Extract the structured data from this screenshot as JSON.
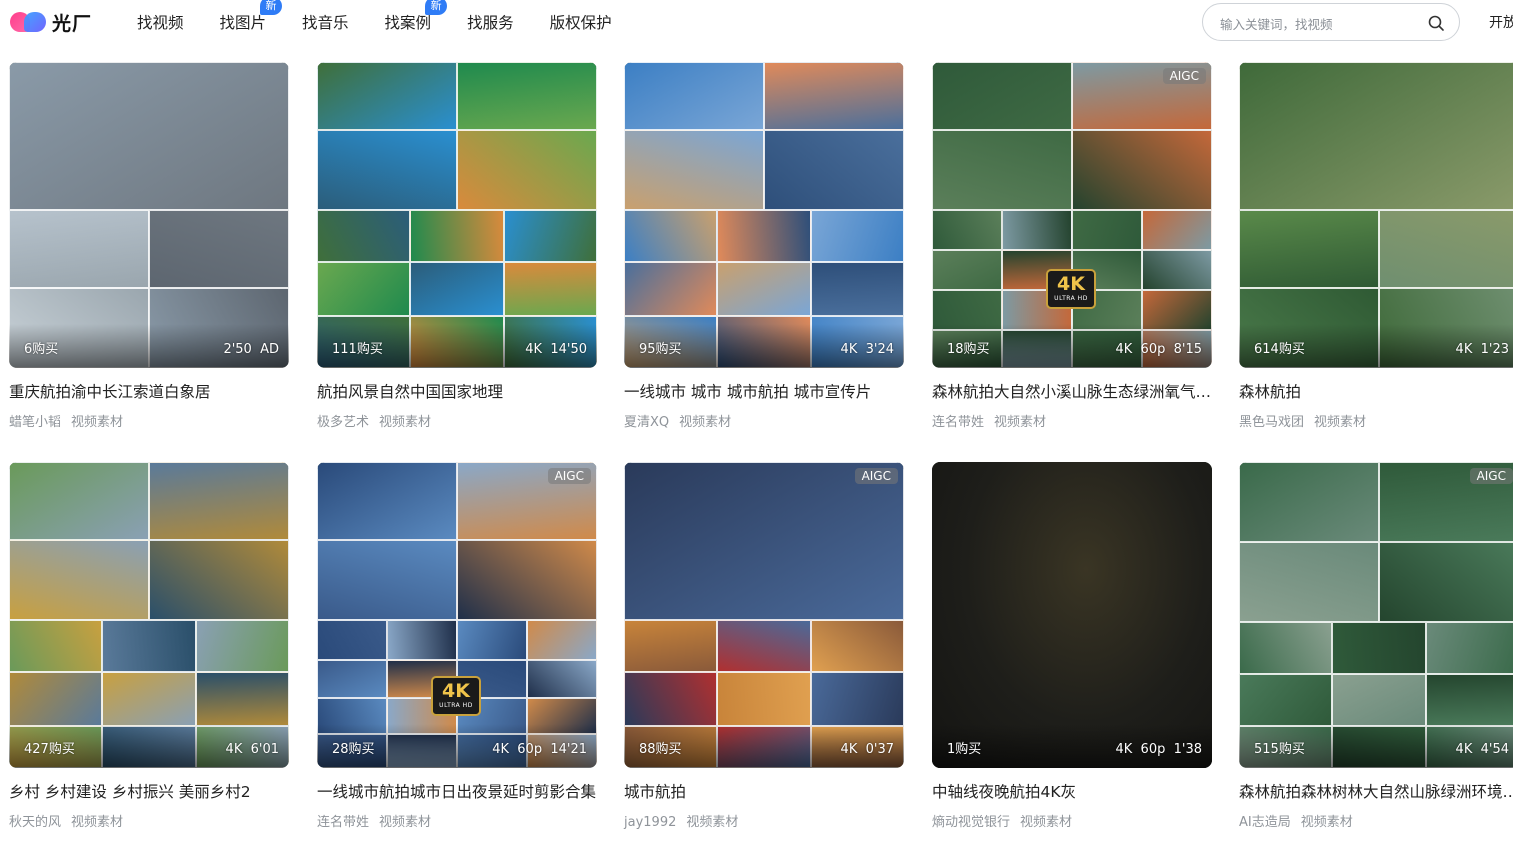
{
  "header": {
    "logo_text": "光厂",
    "nav": [
      {
        "label": "找视频",
        "badge": ""
      },
      {
        "label": "找图片",
        "badge": "新"
      },
      {
        "label": "找音乐",
        "badge": ""
      },
      {
        "label": "找案例",
        "badge": "新"
      },
      {
        "label": "找服务",
        "badge": ""
      },
      {
        "label": "版权保护",
        "badge": ""
      }
    ],
    "search_placeholder": "输入关键词，找视频",
    "open_label": "开放"
  },
  "cards": [
    {
      "title": "重庆航拍渝中长江索道白象居",
      "author": "蜡笔小韬",
      "category": "视频素材",
      "purchases": "6购买",
      "meta": "2'50  AD",
      "aigc": "",
      "k4": false,
      "palette": [
        "#8a9aa8",
        "#b6c2cc",
        "#6e7780",
        "#9aa6ae",
        "#5d6670",
        "#c9d2d8"
      ]
    },
    {
      "title": "航拍风景自然中国国家地理",
      "author": "极多艺术",
      "category": "视频素材",
      "purchases": "111购买",
      "meta": "4K  14'50",
      "aigc": "",
      "k4": false,
      "palette": [
        "#3f6f3a",
        "#1f8a4e",
        "#2a8fd0",
        "#6aa84f",
        "#2b5d7a",
        "#d98a3c"
      ]
    },
    {
      "title": "一线城市 城市 城市航拍 城市宣传片",
      "author": "夏清XQ",
      "category": "视频素材",
      "purchases": "95购买",
      "meta": "4K  3'24",
      "aigc": "",
      "k4": false,
      "palette": [
        "#3c7fc4",
        "#e08a5a",
        "#7aa6d6",
        "#4a6f9c",
        "#c9a06e",
        "#2e4f7a"
      ]
    },
    {
      "title": "森林航拍大自然小溪山脉生态绿洲氧气清新视频",
      "author": "连名带姓",
      "category": "视频素材",
      "purchases": "18购买",
      "meta": "4K  60p  8'15",
      "aigc": "AIGC",
      "k4": true,
      "palette": [
        "#2f5a3a",
        "#7d9aa3",
        "#3f6a44",
        "#c4683a",
        "#5b7f5a",
        "#24432e"
      ]
    },
    {
      "title": "森林航拍",
      "author": "黑色马戏团",
      "category": "视频素材",
      "purchases": "614购买",
      "meta": "4K  1'23",
      "aigc": "",
      "k4": false,
      "palette": [
        "#3f6a3a",
        "#5a8a4a",
        "#8a9a6a",
        "#2f5a34",
        "#6f8f70",
        "#4a7a4a"
      ]
    },
    {
      "title": "乡村 乡村建设 乡村振兴 美丽乡村2",
      "author": "秋天的风",
      "category": "视频素材",
      "purchases": "427购买",
      "meta": "4K  6'01",
      "aigc": "",
      "k4": false,
      "palette": [
        "#6a9a5a",
        "#5a7a9a",
        "#8aa0b4",
        "#b08a3a",
        "#c8a040",
        "#2a4f6a"
      ]
    },
    {
      "title": "一线城市航拍城市日出夜景延时剪影合集",
      "author": "连名带姓",
      "category": "视频素材",
      "purchases": "28购买",
      "meta": "4K  60p  14'21",
      "aigc": "AIGC",
      "k4": true,
      "palette": [
        "#2a4a7a",
        "#8aa8c8",
        "#5a8ac0",
        "#d08a4a",
        "#3a5a8a",
        "#1f2f4a"
      ]
    },
    {
      "title": "城市航拍",
      "author": "jay1992",
      "category": "视频素材",
      "purchases": "88购买",
      "meta": "4K  0'37",
      "aigc": "AIGC",
      "k4": false,
      "palette": [
        "#2a3a5a",
        "#c8843a",
        "#4a6a9a",
        "#8a5a3a",
        "#b03030",
        "#e0a050"
      ]
    },
    {
      "title": "中轴线夜晚航拍4K灰",
      "author": "熵动视觉银行",
      "category": "视频素材",
      "purchases": "1购买",
      "meta": "4K  60p  1'38",
      "aigc": "",
      "k4": false,
      "palette": [
        "#1e1e1c",
        "#26261f",
        "#2a2a22",
        "#1a1a18",
        "#30302a",
        "#222220"
      ]
    },
    {
      "title": "森林航拍森林树林大自然山脉绿洲环境生态保护",
      "author": "AI志造局",
      "category": "视频素材",
      "purchases": "515购买",
      "meta": "4K  4'54",
      "aigc": "AIGC",
      "k4": false,
      "palette": [
        "#3a6a4a",
        "#2f5a3a",
        "#6a8a7a",
        "#4a7a5a",
        "#8aa090",
        "#24452e"
      ]
    }
  ]
}
